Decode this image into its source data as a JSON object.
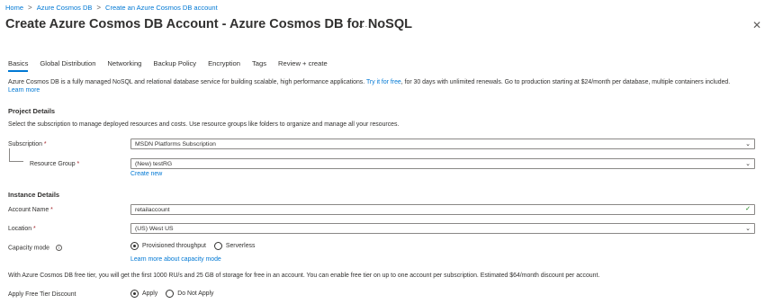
{
  "breadcrumb": {
    "items": [
      "Home",
      "Azure Cosmos DB",
      "Create an Azure Cosmos DB account"
    ],
    "separator": ">"
  },
  "page": {
    "title": "Create Azure Cosmos DB Account - Azure Cosmos DB for NoSQL",
    "more": "...",
    "close": "✕"
  },
  "tabs": [
    "Basics",
    "Global Distribution",
    "Networking",
    "Backup Policy",
    "Encryption",
    "Tags",
    "Review + create"
  ],
  "intro": {
    "text_before": "Azure Cosmos DB is a fully managed NoSQL and relational database service for building scalable, high performance applications.",
    "try_link": "Try it for free",
    "text_after": ", for 30 days with unlimited renewals. Go to production starting at $24/month per database, multiple containers included.",
    "learn_more": "Learn more"
  },
  "project": {
    "heading": "Project Details",
    "description": "Select the subscription to manage deployed resources and costs. Use resource groups like folders to organize and manage all your resources.",
    "subscription_label": "Subscription",
    "subscription_value": "MSDN Platforms Subscription",
    "rg_label": "Resource Group",
    "rg_value": "(New) testRG",
    "create_new": "Create new",
    "required_mark": "*"
  },
  "instance": {
    "heading": "Instance Details",
    "account_label": "Account Name",
    "account_value": "retailaccount",
    "location_label": "Location",
    "location_value": "(US) West US",
    "capacity_label": "Capacity mode",
    "capacity_options": [
      "Provisioned throughput",
      "Serverless"
    ],
    "capacity_selected": "Provisioned throughput",
    "capacity_link": "Learn more about capacity mode",
    "free_tier_text": "With Azure Cosmos DB free tier, you will get the first 1000 RU/s and 25 GB of storage for free in an account. You can enable free tier on up to one account per subscription. Estimated $64/month discount per account.",
    "free_tier_label": "Apply Free Tier Discount",
    "free_tier_options": [
      "Apply",
      "Do Not Apply"
    ],
    "free_tier_selected": "Apply"
  },
  "colors": {
    "accent": "#0078d4",
    "required": "#a4262c",
    "valid": "#107c10"
  },
  "icons": [
    "ellipsis-icon",
    "close-icon",
    "chevron-down-icon",
    "checkmark-icon",
    "info-icon"
  ]
}
